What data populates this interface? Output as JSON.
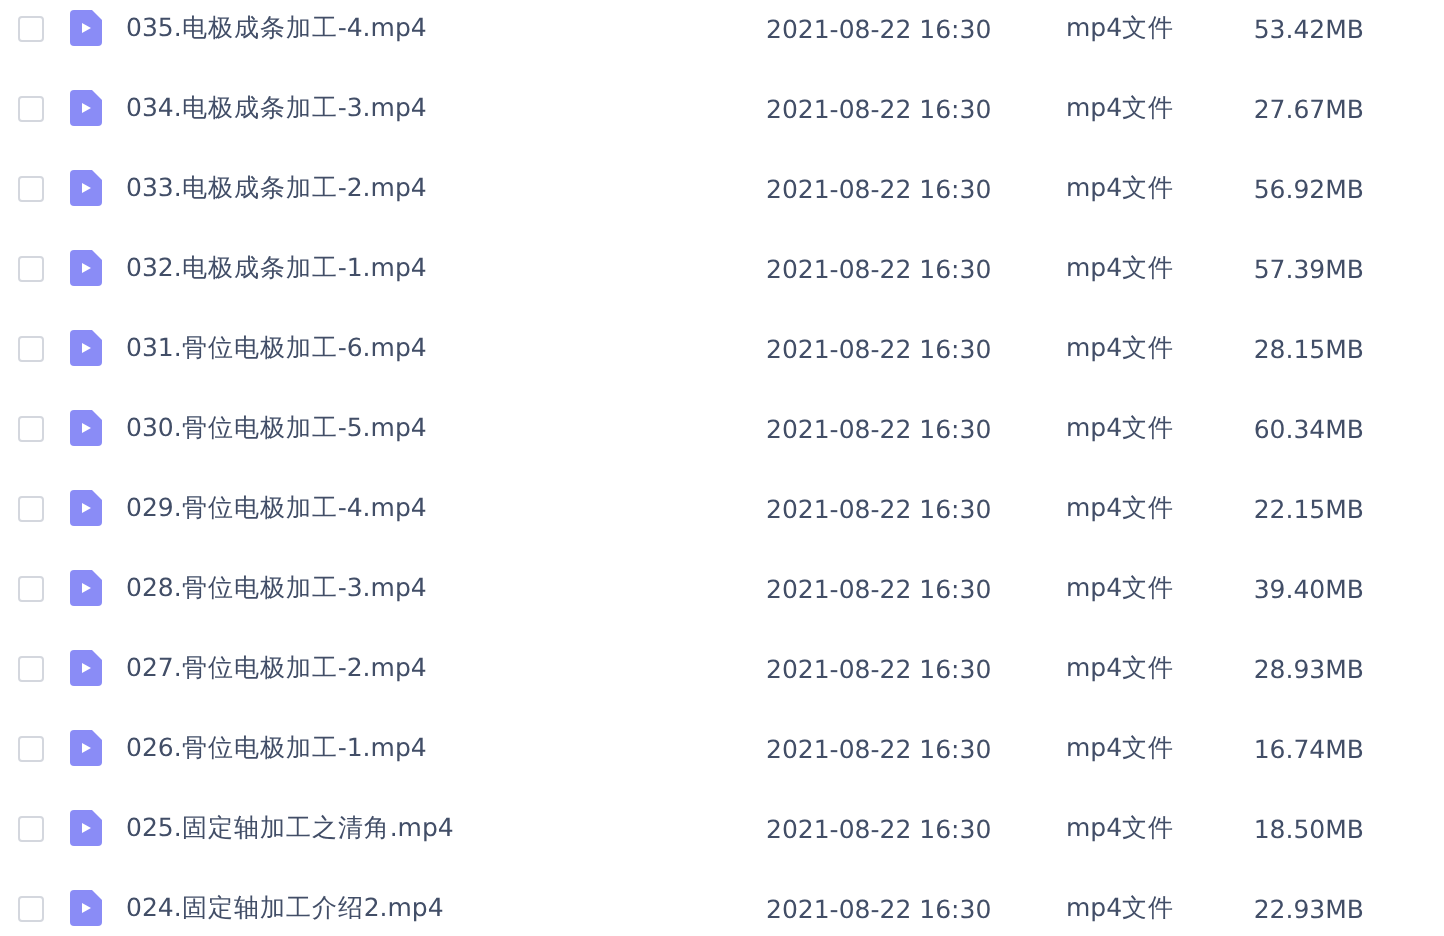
{
  "files": [
    {
      "name": "035.电极成条加工-4.mp4",
      "modified": "2021-08-22 16:30",
      "type": "mp4文件",
      "size": "53.42MB",
      "checked": false
    },
    {
      "name": "034.电极成条加工-3.mp4",
      "modified": "2021-08-22 16:30",
      "type": "mp4文件",
      "size": "27.67MB",
      "checked": false
    },
    {
      "name": "033.电极成条加工-2.mp4",
      "modified": "2021-08-22 16:30",
      "type": "mp4文件",
      "size": "56.92MB",
      "checked": false
    },
    {
      "name": "032.电极成条加工-1.mp4",
      "modified": "2021-08-22 16:30",
      "type": "mp4文件",
      "size": "57.39MB",
      "checked": false
    },
    {
      "name": "031.骨位电极加工-6.mp4",
      "modified": "2021-08-22 16:30",
      "type": "mp4文件",
      "size": "28.15MB",
      "checked": false
    },
    {
      "name": "030.骨位电极加工-5.mp4",
      "modified": "2021-08-22 16:30",
      "type": "mp4文件",
      "size": "60.34MB",
      "checked": false
    },
    {
      "name": "029.骨位电极加工-4.mp4",
      "modified": "2021-08-22 16:30",
      "type": "mp4文件",
      "size": "22.15MB",
      "checked": false
    },
    {
      "name": "028.骨位电极加工-3.mp4",
      "modified": "2021-08-22 16:30",
      "type": "mp4文件",
      "size": "39.40MB",
      "checked": false
    },
    {
      "name": "027.骨位电极加工-2.mp4",
      "modified": "2021-08-22 16:30",
      "type": "mp4文件",
      "size": "28.93MB",
      "checked": false
    },
    {
      "name": "026.骨位电极加工-1.mp4",
      "modified": "2021-08-22 16:30",
      "type": "mp4文件",
      "size": "16.74MB",
      "checked": false
    },
    {
      "name": "025.固定轴加工之清角.mp4",
      "modified": "2021-08-22 16:30",
      "type": "mp4文件",
      "size": "18.50MB",
      "checked": false
    },
    {
      "name": "024.固定轴加工介绍2.mp4",
      "modified": "2021-08-22 16:30",
      "type": "mp4文件",
      "size": "22.93MB",
      "checked": false
    }
  ]
}
